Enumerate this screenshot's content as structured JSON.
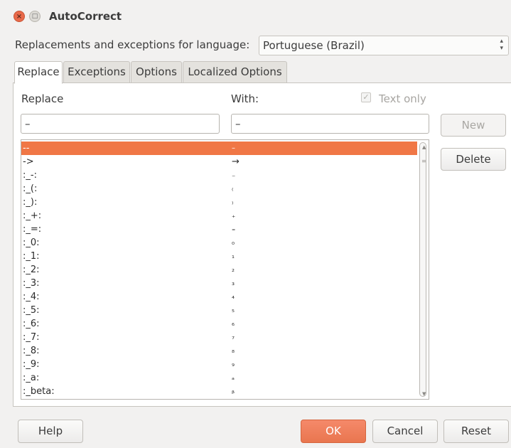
{
  "window": {
    "title": "AutoCorrect"
  },
  "language": {
    "label": "Replacements and exceptions for language:",
    "value": "Portuguese (Brazil)"
  },
  "tabs": [
    {
      "label": "Replace",
      "active": true
    },
    {
      "label": "Exceptions",
      "active": false
    },
    {
      "label": "Options",
      "active": false
    },
    {
      "label": "Localized Options",
      "active": false
    }
  ],
  "replace_tab": {
    "replace_label": "Replace",
    "with_label": "With:",
    "text_only_label": "Text only",
    "text_only_checked": true,
    "replace_value": "–",
    "with_value": "–",
    "new_label": "New",
    "delete_label": "Delete",
    "rows": [
      {
        "replace": "--",
        "with": "–",
        "selected": true
      },
      {
        "replace": "->",
        "with": "→"
      },
      {
        "replace": ":_-:",
        "with": "₋"
      },
      {
        "replace": ":_(:",
        "with": "₍"
      },
      {
        "replace": ":_):",
        "with": "₎"
      },
      {
        "replace": ":_+:",
        "with": "₊"
      },
      {
        "replace": ":_=:",
        "with": "₌"
      },
      {
        "replace": ":_0:",
        "with": "₀"
      },
      {
        "replace": ":_1:",
        "with": "₁"
      },
      {
        "replace": ":_2:",
        "with": "₂"
      },
      {
        "replace": ":_3:",
        "with": "₃"
      },
      {
        "replace": ":_4:",
        "with": "₄"
      },
      {
        "replace": ":_5:",
        "with": "₅"
      },
      {
        "replace": ":_6:",
        "with": "₆"
      },
      {
        "replace": ":_7:",
        "with": "₇"
      },
      {
        "replace": ":_8:",
        "with": "₈"
      },
      {
        "replace": ":_9:",
        "with": "₉"
      },
      {
        "replace": ":_a:",
        "with": "ₐ"
      },
      {
        "replace": ":_beta:",
        "with": "ᵦ"
      }
    ]
  },
  "footer": {
    "help": "Help",
    "ok": "OK",
    "cancel": "Cancel",
    "reset": "Reset"
  },
  "colors": {
    "accent": "#f07746",
    "background": "#f2f1f0"
  }
}
